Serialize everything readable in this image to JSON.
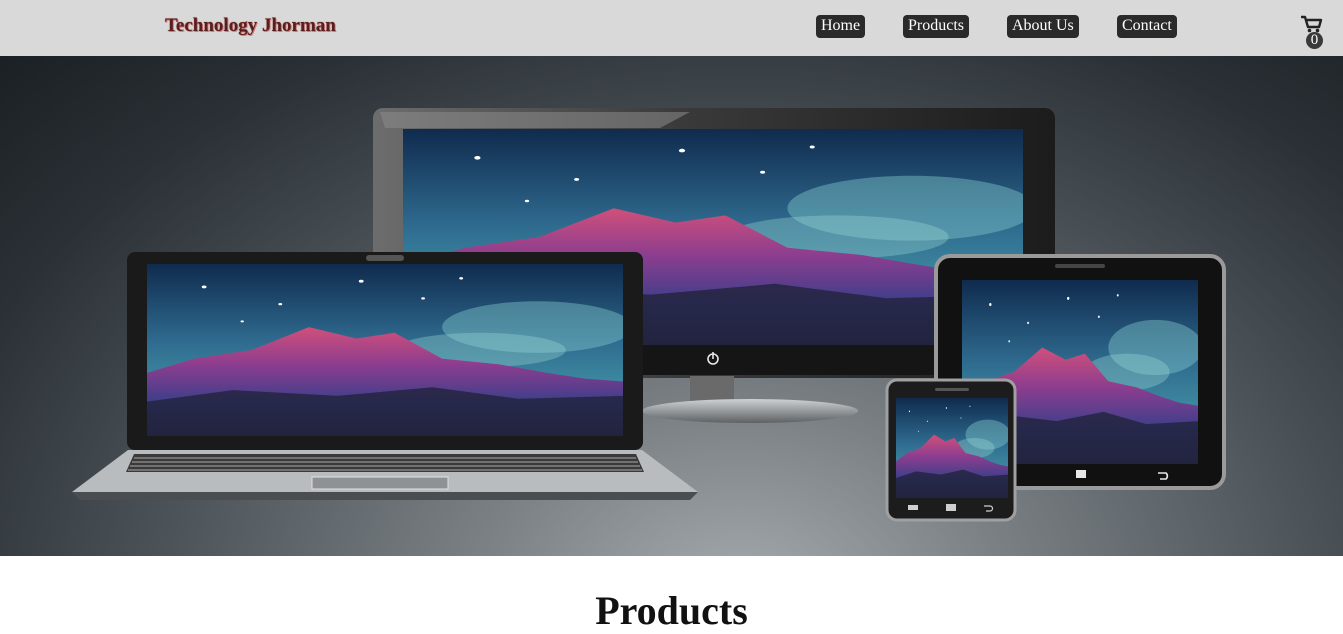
{
  "brand": {
    "name": "Technology Jhorman"
  },
  "nav": {
    "items": [
      {
        "label": "Home"
      },
      {
        "label": "Products"
      },
      {
        "label": "About Us"
      },
      {
        "label": "Contact"
      }
    ]
  },
  "cart": {
    "count": "0",
    "icon": "cart-icon"
  },
  "hero": {
    "image": "responsive-devices-mountain-illustration"
  },
  "main": {
    "section_title": "Products"
  },
  "colors": {
    "navbar_bg": "#d9d9d9",
    "nav_button_bg": "#2a2a2a",
    "brand_color": "#5a1e1e"
  }
}
